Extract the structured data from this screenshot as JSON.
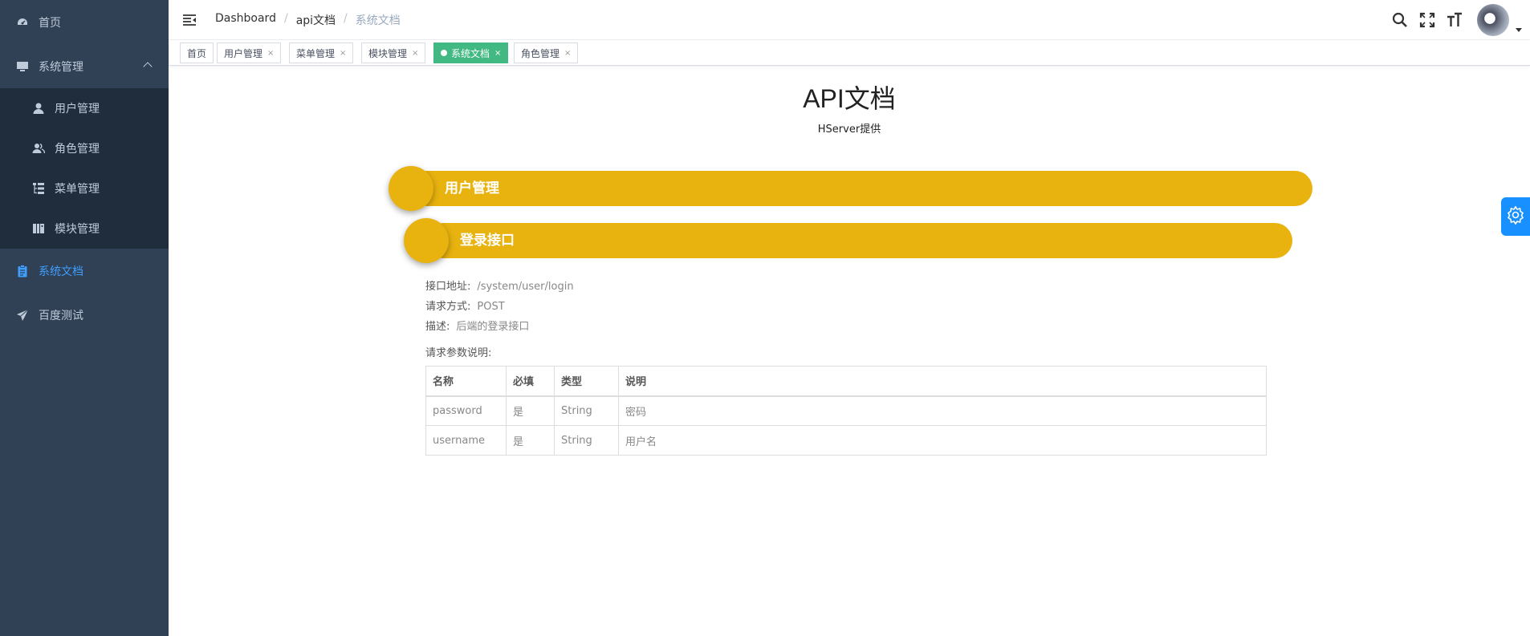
{
  "sidebar": {
    "items": [
      {
        "label": "首页",
        "icon": "dashboard-icon"
      },
      {
        "label": "系统管理",
        "icon": "monitor-icon",
        "expanded": true
      },
      {
        "label": "系统文档",
        "icon": "clipboard-icon",
        "active": true
      },
      {
        "label": "百度测试",
        "icon": "paper-plane-icon"
      }
    ],
    "submenu": [
      {
        "label": "用户管理",
        "icon": "user-icon"
      },
      {
        "label": "角色管理",
        "icon": "peoples-icon"
      },
      {
        "label": "菜单管理",
        "icon": "tree-table-icon"
      },
      {
        "label": "模块管理",
        "icon": "module-icon"
      }
    ]
  },
  "navbar": {
    "breadcrumb": [
      "Dashboard",
      "api文档",
      "系统文档"
    ],
    "separator": "/"
  },
  "tags": [
    {
      "label": "首页",
      "closable": false
    },
    {
      "label": "用户管理",
      "closable": true
    },
    {
      "label": "菜单管理",
      "closable": true
    },
    {
      "label": "模块管理",
      "closable": true
    },
    {
      "label": "系统文档",
      "closable": true,
      "active": true
    },
    {
      "label": "角色管理",
      "closable": true
    }
  ],
  "tag_close": "×",
  "doc": {
    "title": "API文档",
    "subtitle": "HServer提供",
    "section": "用户管理",
    "api": {
      "name": "登录接口",
      "url_label": "接口地址:",
      "url": "/system/user/login",
      "method_label": "请求方式:",
      "method": "POST",
      "desc_label": "描述:",
      "desc": "后端的登录接口",
      "params_label": "请求参数说明:"
    },
    "table": {
      "headers": [
        "名称",
        "必填",
        "类型",
        "说明"
      ],
      "rows": [
        [
          "password",
          "是",
          "String",
          "密码"
        ],
        [
          "username",
          "是",
          "String",
          "用户名"
        ]
      ]
    }
  },
  "colors": {
    "sidebar_bg": "#304156",
    "submenu_bg": "#1f2d3d",
    "active_menu": "#409eff",
    "active_tag": "#42b983",
    "section_bar": "#e8b30f",
    "settings_tab": "#1890ff"
  }
}
